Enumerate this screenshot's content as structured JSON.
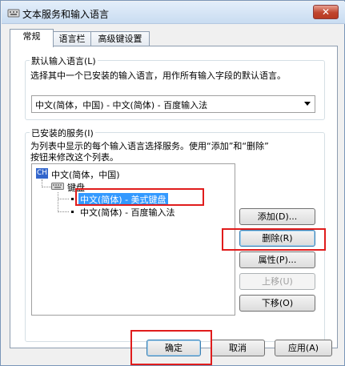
{
  "window": {
    "title": "文本服务和输入语言",
    "close_label": "✕"
  },
  "tabs": [
    {
      "label": "常规",
      "active": true
    },
    {
      "label": "语言栏",
      "active": false
    },
    {
      "label": "高级键设置",
      "active": false
    }
  ],
  "default_language": {
    "group_label": "默认输入语言(L)",
    "description": "选择其中一个已安装的输入语言，用作所有输入字段的默认语言。",
    "selected_value": "中文(简体，中国) - 中文(简体) - 百度输入法"
  },
  "installed_services": {
    "group_label": "已安装的服务(I)",
    "description_line1": "为列表中显示的每个输入语言选择服务。使用“添加”和“删除”",
    "description_line2": "按钮来修改这个列表。",
    "tree": {
      "language_badge": "CH",
      "language": "中文(简体，中国)",
      "category": "键盘",
      "items": [
        {
          "label": "中文(简体) - 美式键盘",
          "selected": true
        },
        {
          "label": "中文(简体) - 百度输入法",
          "selected": false
        }
      ]
    },
    "buttons": {
      "add": "添加(D)...",
      "remove": "删除(R)",
      "properties": "属性(P)...",
      "move_up": "上移(U)",
      "move_down": "下移(O)"
    }
  },
  "footer": {
    "ok": "确定",
    "cancel": "取消",
    "apply": "应用(A)"
  },
  "colors": {
    "selection": "#3399ff",
    "highlight_box": "#e01c1c"
  }
}
